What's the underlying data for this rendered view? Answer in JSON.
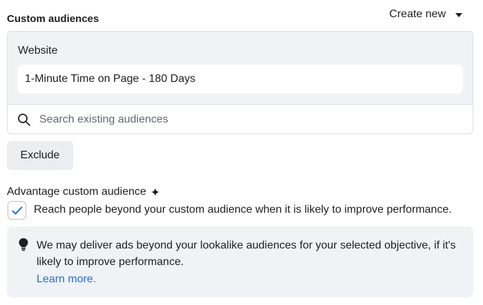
{
  "header": {
    "title": "Custom audiences",
    "create_new_label": "Create new"
  },
  "audiences": {
    "group_label": "Website",
    "selected": "1-Minute Time on Page - 180 Days"
  },
  "search": {
    "placeholder": "Search existing audiences",
    "value": ""
  },
  "exclude_label": "Exclude",
  "advantage": {
    "title": "Advantage custom audience",
    "checkbox_checked": true,
    "checkbox_label": "Reach people beyond your custom audience when it is likely to improve performance."
  },
  "info": {
    "text": "We may deliver ads beyond your lookalike audiences for your selected objective, if it's likely to improve performance.",
    "link_label": "Learn more."
  },
  "colors": {
    "accent": "#216fdb",
    "panel": "#f0f2f5",
    "border": "#dadde1"
  },
  "icons": {
    "search": "search-icon",
    "sparkle": "sparkle-icon",
    "check": "checkmark-icon",
    "bulb": "lightbulb-icon",
    "caret": "caret-down-icon"
  }
}
